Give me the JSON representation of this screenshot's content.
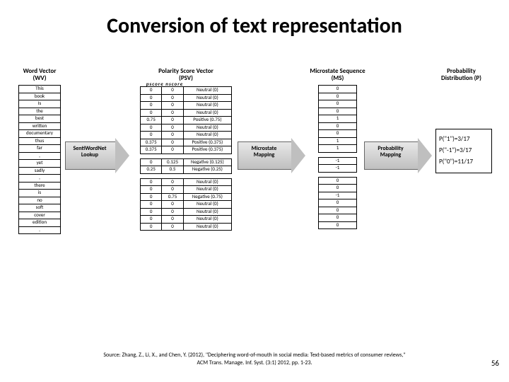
{
  "title": "Conversion of text representation",
  "headers": {
    "wv": "Word Vector\n(WV)",
    "psv": "Polarity Score Vector\n(PSV)",
    "psv_cols": "pscore  nscore",
    "ms": "Microstate Sequence\n(MS)",
    "p": "Probability\nDistribution (P)"
  },
  "arrows": {
    "a1": "SentiWordNet\nLookup",
    "a2": "Microstate\nMapping",
    "a3": "Probability\nMapping"
  },
  "wv": [
    "This",
    "book",
    "Is",
    "the",
    "best",
    "written",
    "documentary",
    "thus",
    "far",
    ",",
    "yet",
    "sadly",
    ",",
    "there",
    "is",
    "no",
    "soft",
    "cover",
    "edition",
    "."
  ],
  "psv": [
    {
      "p": "0",
      "n": "0",
      "lbl": "Neutral (0)"
    },
    {
      "p": "0",
      "n": "0",
      "lbl": "Neutral (0)"
    },
    {
      "p": "0",
      "n": "0",
      "lbl": "Neutral (0)"
    },
    {
      "p": "0",
      "n": "0",
      "lbl": "Neutral (0)"
    },
    {
      "p": "0.75",
      "n": "0",
      "lbl": "Positive (0.75)"
    },
    {
      "p": "0",
      "n": "0",
      "lbl": "Neutral (0)"
    },
    {
      "p": "0",
      "n": "0",
      "lbl": "Neutral (0)"
    },
    {
      "p": "0.375",
      "n": "0",
      "lbl": "Positive (0.375)"
    },
    {
      "p": "0.375",
      "n": "0",
      "lbl": "Positive (0.375)"
    },
    {
      "p": "",
      "n": "",
      "lbl": ""
    },
    {
      "p": "0",
      "n": "0.125",
      "lbl": "Negative (0.125)"
    },
    {
      "p": "0.25",
      "n": "0.5",
      "lbl": "Negative (0.25)"
    },
    {
      "p": "",
      "n": "",
      "lbl": ""
    },
    {
      "p": "0",
      "n": "0",
      "lbl": "Neutral (0)"
    },
    {
      "p": "0",
      "n": "0",
      "lbl": "Neutral (0)"
    },
    {
      "p": "0",
      "n": "0.75",
      "lbl": "Negative (0.75)"
    },
    {
      "p": "0",
      "n": "0",
      "lbl": "Neutral (0)"
    },
    {
      "p": "0",
      "n": "0",
      "lbl": "Neutral (0)"
    },
    {
      "p": "0",
      "n": "0",
      "lbl": "Neutral (0)"
    },
    {
      "p": "0",
      "n": "0",
      "lbl": "Neutral (0)"
    }
  ],
  "ms": [
    "0",
    "0",
    "0",
    "0",
    "1",
    "0",
    "0",
    "1",
    "1",
    "",
    "-1",
    "-1",
    "",
    "0",
    "0",
    "-1",
    "0",
    "0",
    "0",
    "0"
  ],
  "prob": [
    "P(\"1\")=3/17",
    "P(\"-1\")=3/17",
    "P(\"0\")=11/17"
  ],
  "source": "Source: Zhang, Z., Li, X., and Chen, Y. (2012), \"Deciphering word-of-mouth in social media: Text-based metrics of consumer reviews,\"\nACM Trans. Manage. Inf. Syst. (3:1) 2012, pp. 1-23.",
  "pagenum": "56"
}
